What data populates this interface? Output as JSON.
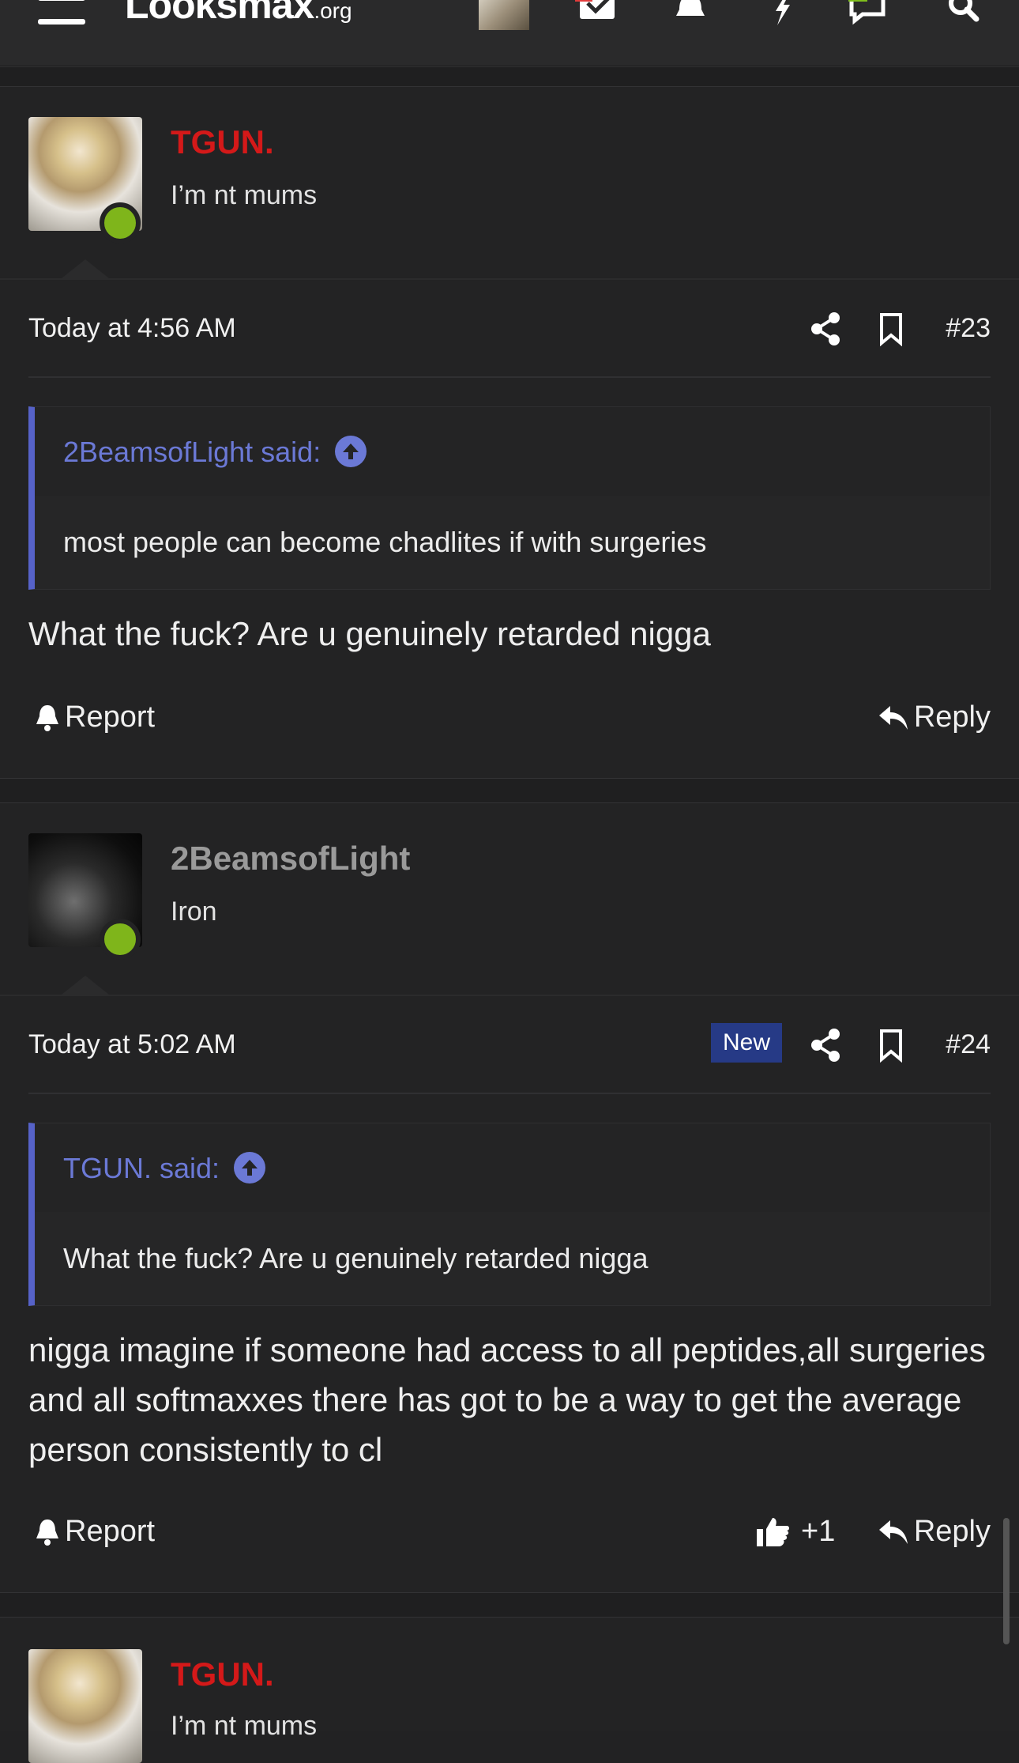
{
  "nav": {
    "logo_main": "Looksmax",
    "logo_suffix": ".org",
    "icons": [
      "menu-icon",
      "user-avatar",
      "inbox-check-icon",
      "bell-icon",
      "lightning-icon",
      "chat-icon",
      "search-icon"
    ],
    "colors": {
      "alert_badge": "#e23b3b",
      "chat_badge": "#7fbf1c"
    }
  },
  "posts": [
    {
      "username": "TGUN.",
      "user_title": "I’m nt mums",
      "timestamp": "Today at 4:56 AM",
      "post_number": "#23",
      "quote": {
        "attribution": "2BeamsofLight said:",
        "text": "most people can become chadlites if with surgeries"
      },
      "body": "What the fuck? Are u genuinely retarded nigga",
      "actions": {
        "report": "Report",
        "reply": "Reply"
      }
    },
    {
      "username": "2BeamsofLight",
      "user_title": "Iron",
      "timestamp": "Today at 5:02 AM",
      "new_badge": "New",
      "post_number": "#24",
      "quote": {
        "attribution": "TGUN. said:",
        "text": "What the fuck? Are u genuinely retarded nigga"
      },
      "body": "nigga imagine if someone had access to all peptides,all surgeries and all softmaxxes there has got to be a way to get the average person consistently to cl",
      "actions": {
        "report": "Report",
        "like_count": "+1",
        "reply": "Reply"
      }
    },
    {
      "username": "TGUN.",
      "user_title": "I’m nt mums"
    }
  ],
  "colors": {
    "username_red": "#d41919",
    "username_grey": "#9a9a9a",
    "online": "#7fb51b",
    "quote_accent": "#5662c8",
    "new_badge": "#263a86"
  }
}
